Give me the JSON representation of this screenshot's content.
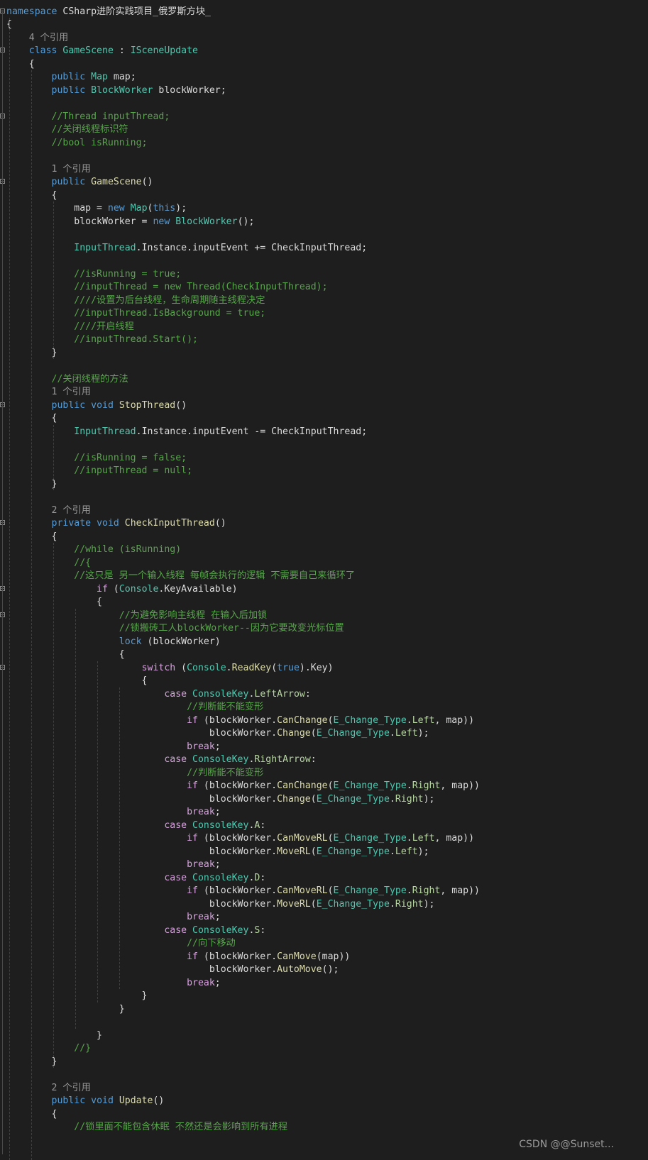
{
  "lines": [
    "namespace CSharp进阶实践项目_俄罗斯方块_",
    "{",
    "    4 个引用",
    "    class GameScene : ISceneUpdate",
    "    {",
    "        public Map map;",
    "        public BlockWorker blockWorker;",
    "",
    "        //Thread inputThread;",
    "        //关闭线程标识符",
    "        //bool isRunning;",
    "",
    "        1 个引用",
    "        public GameScene()",
    "        {",
    "            map = new Map(this);",
    "            blockWorker = new BlockWorker();",
    "",
    "            InputThread.Instance.inputEvent += CheckInputThread;",
    "",
    "            //isRunning = true;",
    "            //inputThread = new Thread(CheckInputThread);",
    "            ////设置为后台线程，生命周期随主线程决定",
    "            //inputThread.IsBackground = true;",
    "            ////开启线程",
    "            //inputThread.Start();",
    "        }",
    "",
    "        //关闭线程的方法",
    "        1 个引用",
    "        public void StopThread()",
    "        {",
    "            InputThread.Instance.inputEvent -= CheckInputThread;",
    "",
    "            //isRunning = false;",
    "            //inputThread = null;",
    "        }",
    "",
    "        2 个引用",
    "        private void CheckInputThread()",
    "        {",
    "            //while (isRunning)",
    "            //{",
    "            //这只是 另一个输入线程 每帧会执行的逻辑 不需要自己来循环了",
    "                if (Console.KeyAvailable)",
    "                {",
    "                    //为避免影响主线程 在输入后加锁",
    "                    //锁搬砖工人blockWorker--因为它要改变光标位置",
    "                    lock (blockWorker)",
    "                    {",
    "                        switch (Console.ReadKey(true).Key)",
    "                        {",
    "                            case ConsoleKey.LeftArrow:",
    "                                //判断能不能变形",
    "                                if (blockWorker.CanChange(E_Change_Type.Left, map))",
    "                                    blockWorker.Change(E_Change_Type.Left);",
    "                                break;",
    "                            case ConsoleKey.RightArrow:",
    "                                //判断能不能变形",
    "                                if (blockWorker.CanChange(E_Change_Type.Right, map))",
    "                                    blockWorker.Change(E_Change_Type.Right);",
    "                                break;",
    "                            case ConsoleKey.A:",
    "                                if (blockWorker.CanMoveRL(E_Change_Type.Left, map))",
    "                                    blockWorker.MoveRL(E_Change_Type.Left);",
    "                                break;",
    "                            case ConsoleKey.D:",
    "                                if (blockWorker.CanMoveRL(E_Change_Type.Right, map))",
    "                                    blockWorker.MoveRL(E_Change_Type.Right);",
    "                                break;",
    "                            case ConsoleKey.S:",
    "                                //向下移动",
    "                                if (blockWorker.CanMove(map))",
    "                                    blockWorker.AutoMove();",
    "                                break;",
    "                        }",
    "                    }",
    "",
    "                }",
    "            //}",
    "        }",
    "",
    "        2 个引用",
    "        public void Update()",
    "        {",
    "            //锁里面不能包含休眠 不然还是会影响到所有进程"
  ],
  "watermark": "CSDN @@Sunset..."
}
